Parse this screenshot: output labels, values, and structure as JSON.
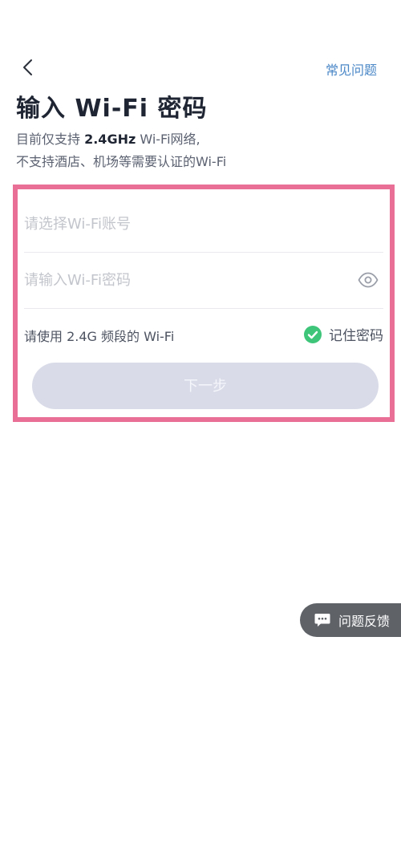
{
  "header": {
    "back_icon": "chevron-left-icon",
    "faq_label": "常见问题"
  },
  "title": "输入 Wi-Fi 密码",
  "subtitle": {
    "line1_prefix": "目前仅支持 ",
    "line1_highlight": "2.4GHz",
    "line1_suffix": " Wi-Fi网络,",
    "line2": "不支持酒店、机场等需要认证的Wi-Fi"
  },
  "form": {
    "ssid_placeholder": "请选择Wi-Fi账号",
    "ssid_value": "",
    "password_placeholder": "请输入Wi-Fi密码",
    "password_value": "",
    "eye_icon": "eye-icon",
    "hint": "请使用 2.4G 频段的 Wi-Fi",
    "remember_label": "记住密码",
    "remember_checked": true,
    "next_label": "下一步"
  },
  "feedback": {
    "label": "问题反馈",
    "icon": "chat-bubble-icon"
  },
  "colors": {
    "accent_link": "#4a87c7",
    "highlight_border": "#ea6f97",
    "check_green": "#3ec57a",
    "button_disabled": "#d9dbe8",
    "feedback_bg": "#5f6368"
  }
}
